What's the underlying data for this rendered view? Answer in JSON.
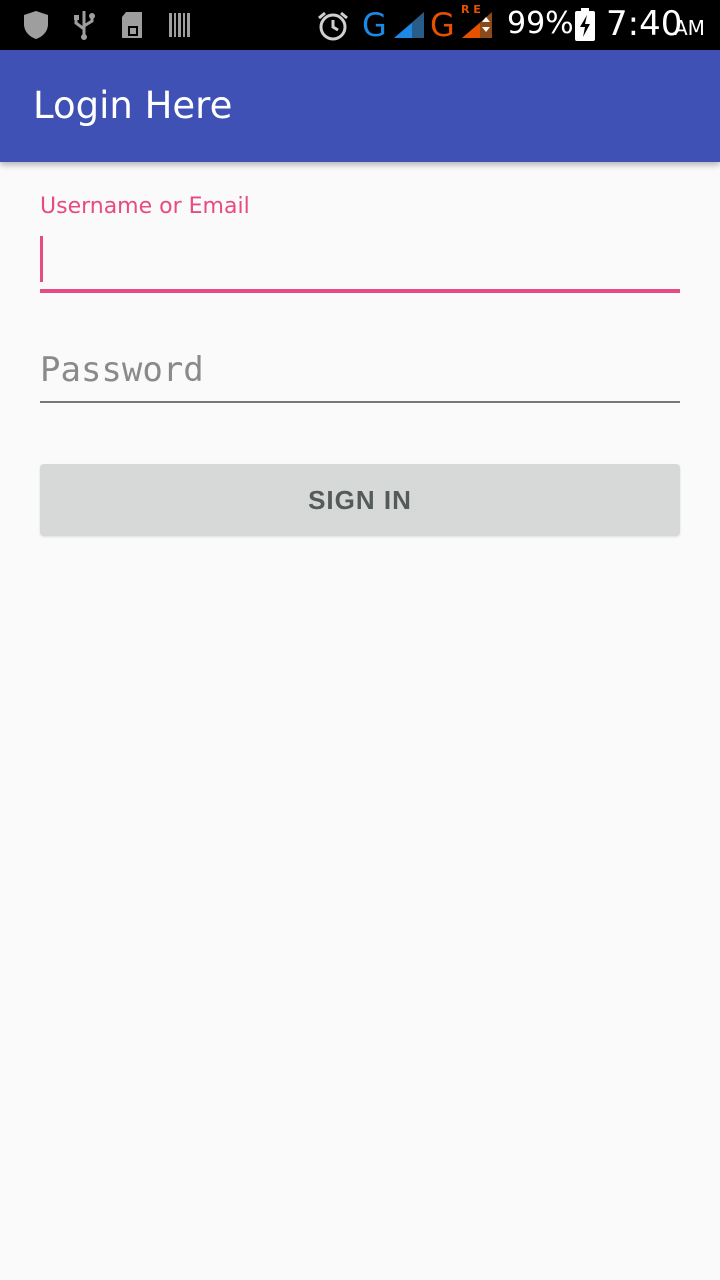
{
  "status_bar": {
    "icons": [
      "shield-icon",
      "usb-icon",
      "sd-card-icon",
      "barcode-icon",
      "alarm-icon",
      "signal-icon",
      "roaming-signal-icon",
      "battery-charging-icon"
    ],
    "network_1": "G",
    "network_2": "G",
    "roaming_label": "R E",
    "battery_percent": "99%",
    "time": "7:40",
    "ampm": "AM"
  },
  "app_bar": {
    "title": "Login Here",
    "color": "#3f51b5"
  },
  "form": {
    "username_label": "Username or Email",
    "username_value": "",
    "password_placeholder": "Password",
    "password_value": "",
    "sign_in_label": "SIGN IN",
    "accent_color": "#e84a84"
  }
}
